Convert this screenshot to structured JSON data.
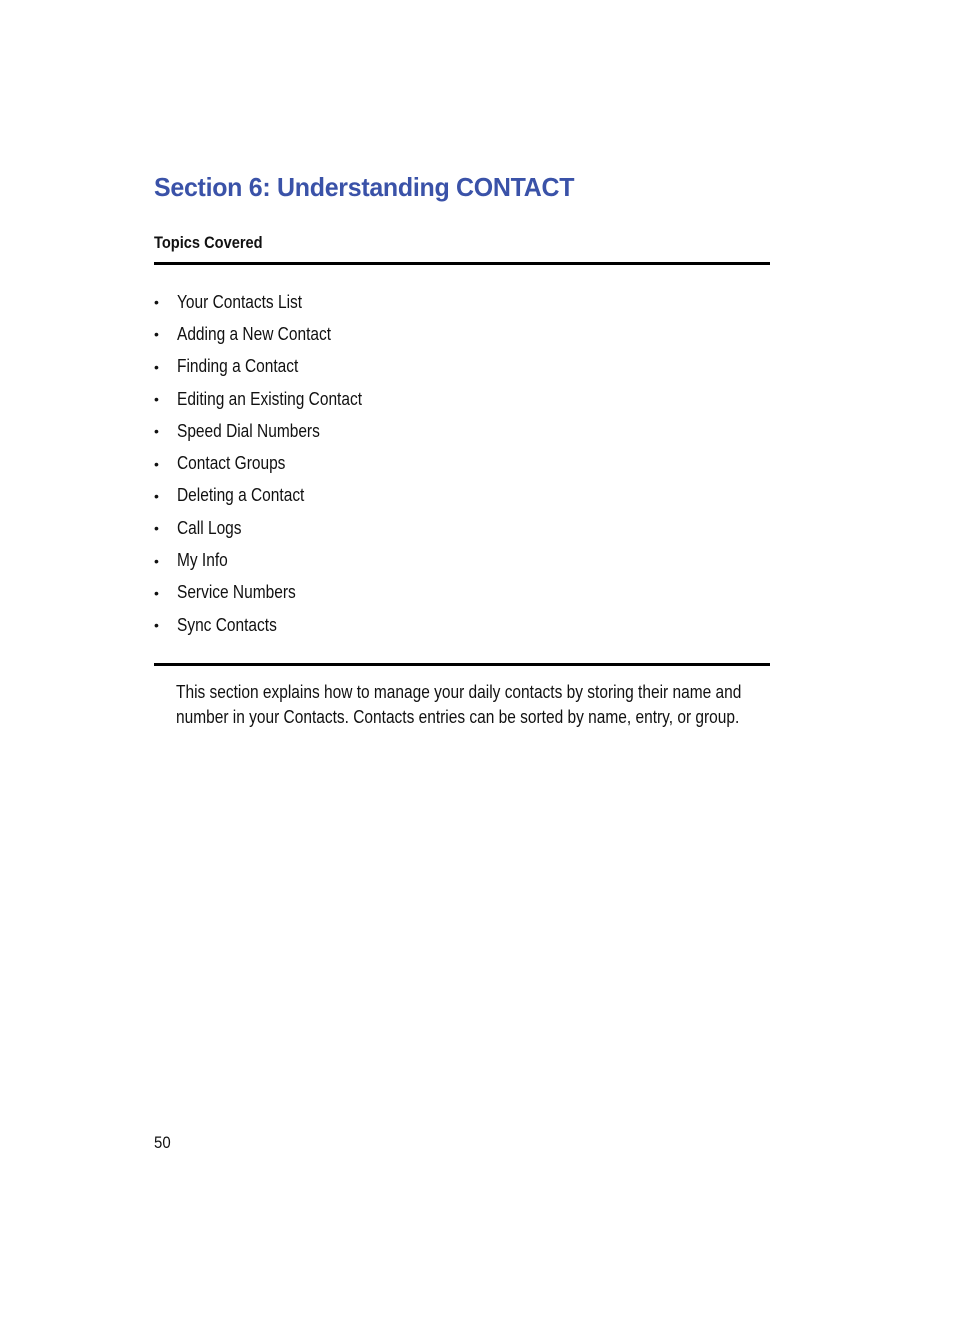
{
  "section": {
    "title": "Section 6: Understanding CONTACT",
    "title_color": "#3a52a8"
  },
  "topics": {
    "label": "Topics Covered",
    "bullet": "•",
    "items": [
      "Your Contacts List",
      "Adding a New Contact",
      "Finding a Contact",
      "Editing an Existing Contact",
      "Speed Dial Numbers",
      "Contact Groups",
      "Deleting a Contact",
      "Call Logs",
      "My Info",
      "Service Numbers",
      "Sync Contacts"
    ]
  },
  "intro": "This section explains how to manage your daily contacts by storing their name and number in your Contacts. Contacts entries can be sorted by name, entry, or group.",
  "footer": {
    "page_number": "50"
  }
}
